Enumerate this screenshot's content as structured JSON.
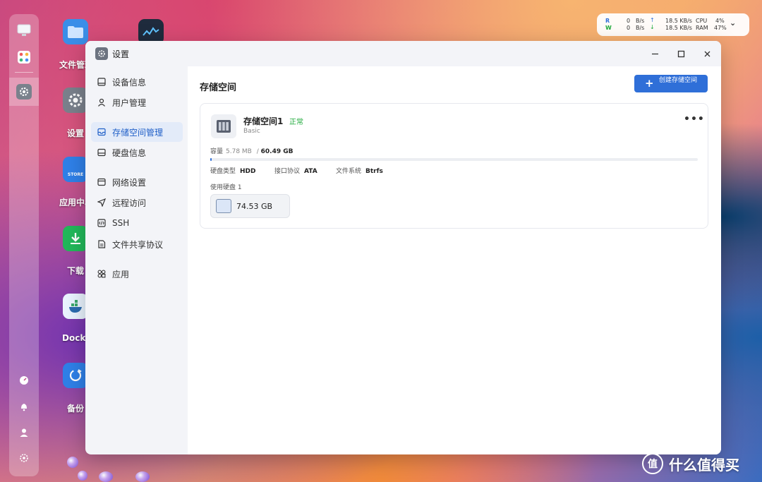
{
  "desktop": {
    "icons": [
      {
        "label": "文件管理",
        "color": "#3a8ee8"
      },
      {
        "label": "设置",
        "color": "#7a818c"
      },
      {
        "label": "应用中心",
        "color": "#2f80e8",
        "badge": "STORE"
      },
      {
        "label": "下载",
        "color": "#22b85a"
      },
      {
        "label": "Docker",
        "color": "#e8f4ff"
      },
      {
        "label": "备份",
        "color": "#2f80e8"
      }
    ]
  },
  "monitor": {
    "r_label": "R",
    "w_label": "W",
    "r_speed": "0",
    "w_speed": "0",
    "unit": "B/s",
    "up_speed": "18.5 KB/s",
    "down_speed": "18.5 KB/s",
    "cpu_label": "CPU",
    "cpu_value": "4%",
    "ram_label": "RAM",
    "ram_value": "47%"
  },
  "window": {
    "title": "设置"
  },
  "sidebar": {
    "items": [
      {
        "label": "设备信息",
        "icon": "device-icon"
      },
      {
        "label": "用户管理",
        "icon": "user-icon"
      },
      {
        "label": "存储空间管理",
        "icon": "storage-icon",
        "active": true
      },
      {
        "label": "硬盘信息",
        "icon": "disk-icon"
      },
      {
        "label": "网络设置",
        "icon": "network-icon"
      },
      {
        "label": "远程访问",
        "icon": "remote-icon"
      },
      {
        "label": "SSH",
        "icon": "ssh-icon"
      },
      {
        "label": "文件共享协议",
        "icon": "file-share-icon"
      },
      {
        "label": "应用",
        "icon": "apps-icon"
      }
    ]
  },
  "main": {
    "title": "存储空间",
    "create_button": "创建存储空间",
    "pool": {
      "name": "存储空间1",
      "status": "正常",
      "type": "Basic",
      "capacity_label": "容量",
      "used": "5.78 MB",
      "separator": "/",
      "total": "60.49 GB",
      "usage_fraction": 0.0001,
      "disk_type_label": "硬盘类型",
      "disk_type": "HDD",
      "interface_label": "接口协议",
      "interface": "ATA",
      "fs_label": "文件系统",
      "fs": "Btrfs",
      "disks_label": "使用硬盘 1",
      "disk_size": "74.53 GB"
    }
  },
  "watermark": {
    "text": "什么值得买",
    "logo": "值"
  },
  "colors": {
    "accent": "#2f6fd8",
    "status_ok": "#1faa3b",
    "active_nav_bg": "#e3ebf9"
  }
}
